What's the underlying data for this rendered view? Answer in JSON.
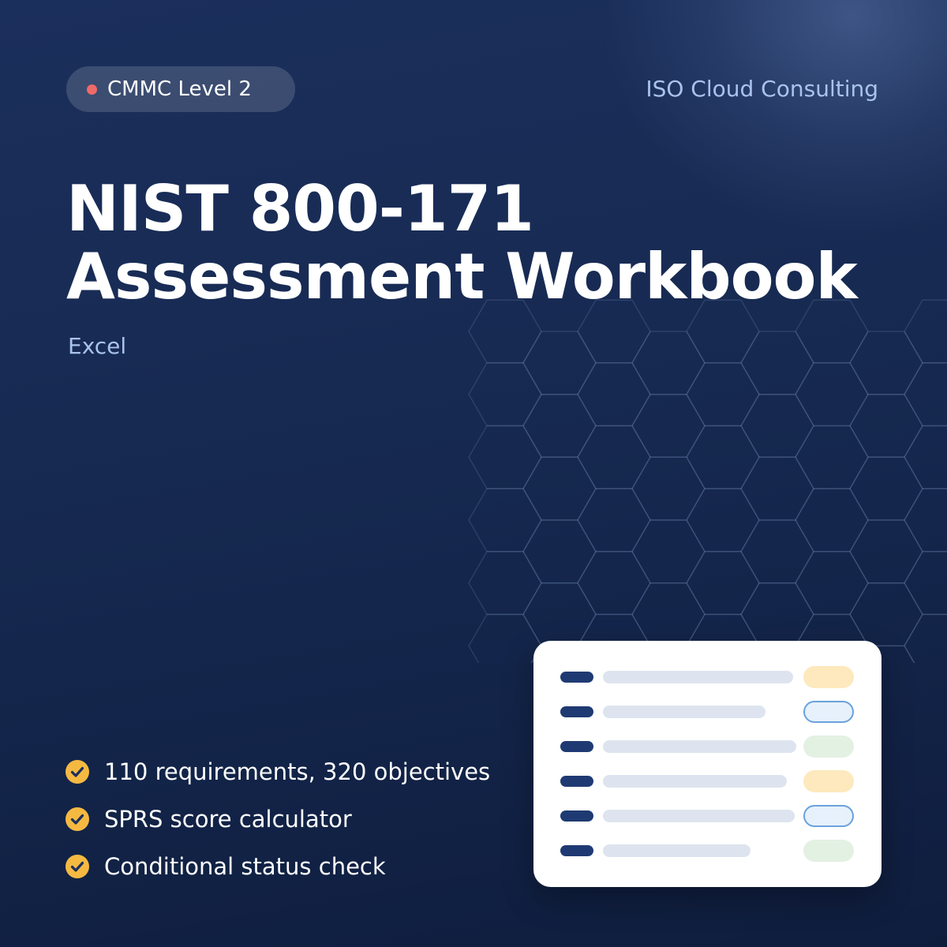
{
  "badge": {
    "label": "CMMC Level 2",
    "dot_color": "#ef6a68"
  },
  "brand": "ISO Cloud Consulting",
  "title": {
    "line1": "NIST 800-171",
    "line2": "Assessment Workbook"
  },
  "subtitle": "Excel",
  "features": [
    {
      "label": "110 requirements, 320 objectives",
      "icon": "check-circle-icon"
    },
    {
      "label": "SPRS score calculator",
      "icon": "check-circle-icon"
    },
    {
      "label": "Conditional status check",
      "icon": "check-circle-icon"
    }
  ],
  "colors": {
    "background": "#172a52",
    "accent_text": "#a9c3ec",
    "check_fill": "#f5b942",
    "card_key": "#1f3a73",
    "card_bar": "#dde4ef"
  },
  "preview_rows": [
    {
      "status": "pending",
      "pill_fill": "#fde9bd",
      "pill_border": ""
    },
    {
      "status": "in-progress",
      "pill_fill": "#e6f1fb",
      "pill_border": "#6aa2dc"
    },
    {
      "status": "complete",
      "pill_fill": "#e3f1e3",
      "pill_border": ""
    },
    {
      "status": "pending",
      "pill_fill": "#fde9bd",
      "pill_border": ""
    },
    {
      "status": "in-progress",
      "pill_fill": "#e6f1fb",
      "pill_border": "#6aa2dc"
    },
    {
      "status": "complete",
      "pill_fill": "#e3f1e3",
      "pill_border": ""
    }
  ]
}
